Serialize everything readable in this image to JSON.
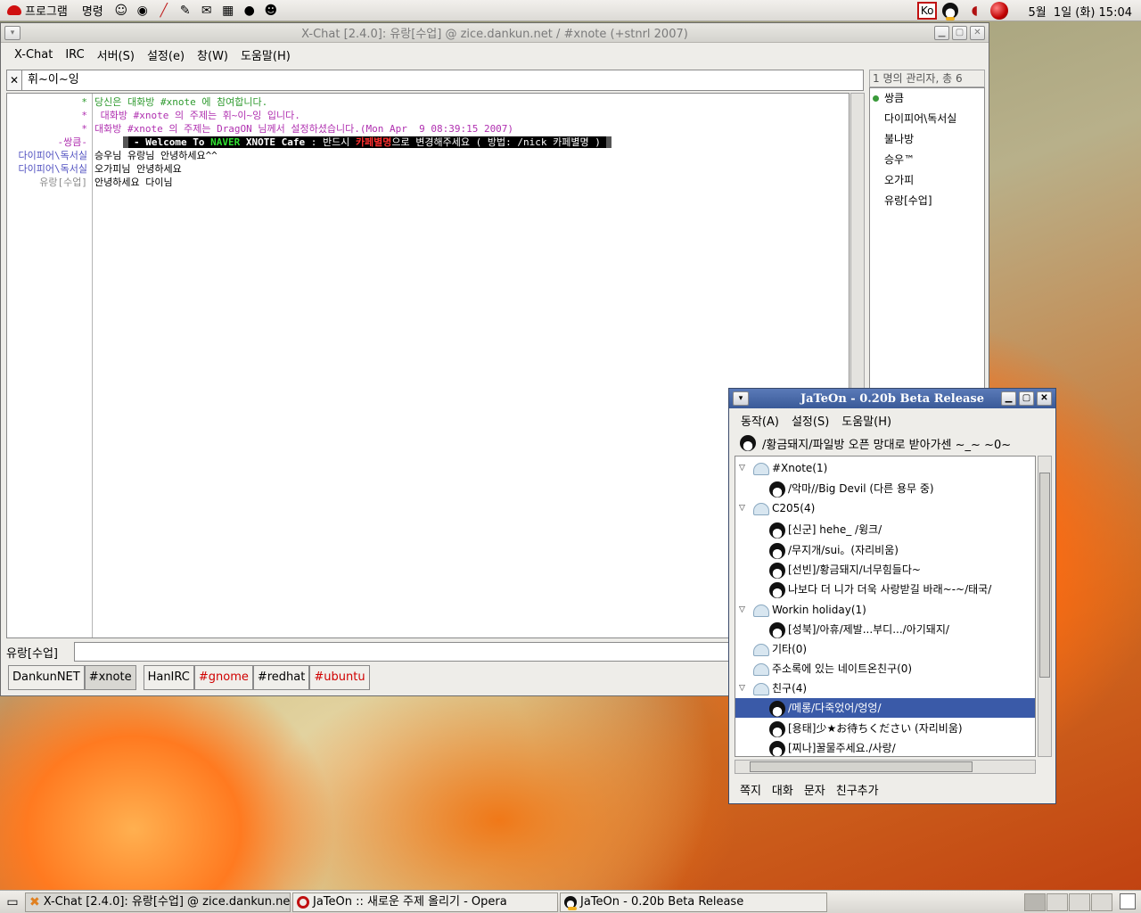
{
  "top_panel": {
    "menus": [
      "프로그램",
      "명령"
    ],
    "input_method": "Ko",
    "clock": "5월  1일 (화) 15:04"
  },
  "xchat": {
    "title": "X-Chat [2.4.0]: 유랑[수업] @ zice.dankun.net / #xnote (+stnrl 2007)",
    "menu": [
      "X-Chat",
      "IRC",
      "서버(S)",
      "설정(e)",
      "창(W)",
      "도움말(H)"
    ],
    "topic": "휘~이~잉",
    "userlist_header": "1 명의 관리자, 총 6",
    "users": [
      "쌍큼",
      "다이피어\\독서실",
      "불나방",
      "승우™",
      "오가피",
      "유랑[수업]"
    ],
    "lines": [
      {
        "nick": "*",
        "text": "당신은 대화방 #xnote 에 참여합니다."
      },
      {
        "nick": "*",
        "text": " 대화방 #xnote 의 주제는 휘~이~잉 입니다."
      },
      {
        "nick": "*",
        "text": "대화방 #xnote 의 주제는 DragON 님께서 설정하셨습니다.(Mon Apr  9 08:39:15 2007)"
      },
      {
        "nick": "-쌍큼-",
        "motd_a": "- Welcome To ",
        "motd_naver": "NAVER",
        "motd_b": " XNOTE Cafe",
        "motd_c": " : 반드시 ",
        "motd_red": "카페별명",
        "motd_d": "으로 변경해주세요 ( 방법: /nick 카페별명 )"
      },
      {
        "nick": "다이피어\\독서실",
        "text": "승우님 유랑님 안녕하세요^^"
      },
      {
        "nick": "다이피어\\독서실",
        "text": "오가피님 안녕하세요"
      },
      {
        "nick": "유랑[수업]",
        "text": "안녕하세요 다이님"
      }
    ],
    "input_nick": "유랑[수업]",
    "tabs": [
      "DankunNET",
      "#xnote",
      "HanIRC",
      "#gnome",
      "#redhat",
      "#ubuntu"
    ]
  },
  "jateon": {
    "title": "JaTeOn - 0.20b Beta Release",
    "menu": [
      "동작(A)",
      "설정(S)",
      "도움말(H)"
    ],
    "status_text": "/황금돼지/파일방 오픈 망대로 받아가센 ~_~ ~0~",
    "tree": [
      {
        "type": "group",
        "label": "#Xnote(1)"
      },
      {
        "type": "buddy",
        "label": "/악마//Big Devil (다른 용무 중)"
      },
      {
        "type": "group",
        "label": "C205(4)"
      },
      {
        "type": "buddy",
        "label": "[신군] hehe_ /윙크/"
      },
      {
        "type": "buddy",
        "label": "/무지개/sui。(자리비움)"
      },
      {
        "type": "buddy",
        "label": "[선빈]/황금돼지/너무힘들다~"
      },
      {
        "type": "buddy",
        "label": "나보다 더 니가 더욱 사랑받길 바래~-~/태국/"
      },
      {
        "type": "group",
        "label": "Workin holiday(1)"
      },
      {
        "type": "buddy",
        "label": "[성북]/아휴/제발...부디.../아기돼지/"
      },
      {
        "type": "group",
        "label": "기타(0)"
      },
      {
        "type": "group",
        "label": "주소록에 있는 네이트온친구(0)"
      },
      {
        "type": "group",
        "label": "친구(4)"
      },
      {
        "type": "buddy",
        "label": "/메롱/다죽었어/엉엉/"
      },
      {
        "type": "buddy",
        "label": "[용태]少★お待ちください (자리비움)"
      },
      {
        "type": "buddy",
        "label": "[찌나]꿀물주세요./사랑/"
      }
    ],
    "bottom_buttons": [
      "쪽지",
      "대화",
      "문자",
      "친구추가"
    ]
  },
  "taskbar": {
    "tasks": [
      "X-Chat [2.4.0]: 유랑[수업] @ zice.dankun.net /",
      "JaTeOn :: 새로운 주제 올리기 - Opera",
      "JaTeOn - 0.20b Beta Release"
    ]
  }
}
